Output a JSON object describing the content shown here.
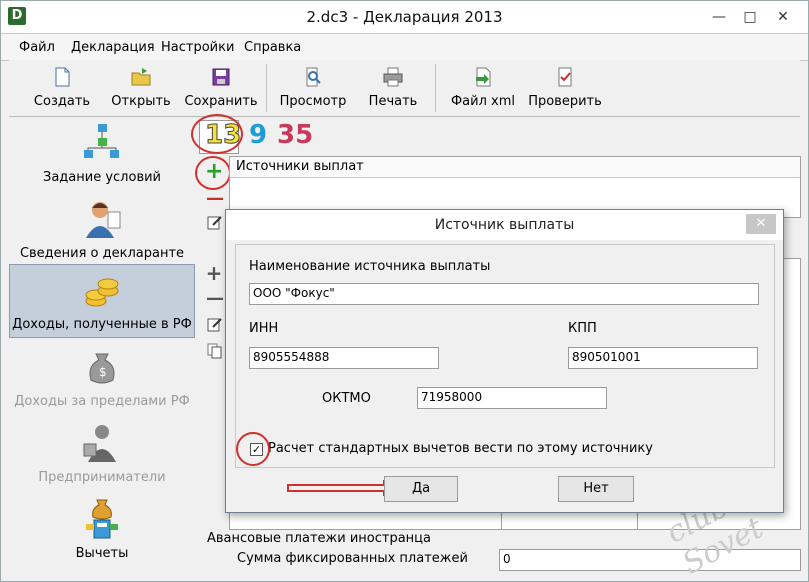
{
  "window": {
    "title": "2.dc3 - Декларация 2013",
    "app_icon": "D",
    "minimize": "—",
    "maximize": "□",
    "close": "✕"
  },
  "menu": [
    "Файл",
    "Декларация",
    "Настройки",
    "Справка"
  ],
  "toolbar": [
    {
      "label": "Создать",
      "icon": "new-document-icon"
    },
    {
      "label": "Открыть",
      "icon": "open-folder-icon"
    },
    {
      "label": "Сохранить",
      "icon": "save-disk-icon"
    },
    {
      "label": "Просмотр",
      "icon": "preview-icon"
    },
    {
      "label": "Печать",
      "icon": "printer-icon"
    },
    {
      "label": "Файл xml",
      "icon": "xml-file-icon"
    },
    {
      "label": "Проверить",
      "icon": "check-document-icon"
    }
  ],
  "sidebar": [
    {
      "label": "Задание условий",
      "icon": "conditions-tree-icon",
      "state": "normal"
    },
    {
      "label": "Сведения о декларанте",
      "icon": "person-icon",
      "state": "normal"
    },
    {
      "label": "Доходы, полученные в РФ",
      "icon": "coins-icon",
      "state": "active"
    },
    {
      "label": "Доходы за пределами РФ",
      "icon": "money-bag-icon",
      "state": "disabled"
    },
    {
      "label": "Предприниматели",
      "icon": "entrepreneur-icon",
      "state": "disabled"
    },
    {
      "label": "Вычеты",
      "icon": "deductions-icon",
      "state": "normal"
    }
  ],
  "rate_tabs": [
    {
      "label": "13",
      "color": "#f2e23a"
    },
    {
      "label": "9",
      "color": "#1f9bd6"
    },
    {
      "label": "35",
      "color": "#c8395a"
    }
  ],
  "income_sources": {
    "header": "Источники выплат"
  },
  "side_actions": {
    "add": "+",
    "remove": "—"
  },
  "dialog": {
    "title": "Источник выплаты",
    "close": "✕",
    "name_label": "Наименование источника выплаты",
    "name_value": "ООО \"Фокус\"",
    "inn_label": "ИНН",
    "inn_value": "8905554888",
    "kpp_label": "КПП",
    "kpp_value": "890501001",
    "oktmo_label": "ОКТМО",
    "oktmo_value": "71958000",
    "std_deductions_label": "Расчет стандартных вычетов вести по этому источнику",
    "std_deductions_checked": "✓",
    "yes_button": "Да",
    "no_button": "Нет"
  },
  "bottom": {
    "group_label": "Авансовые платежи иностранца",
    "fixed_payments_label": "Сумма фиксированных платежей",
    "fixed_payments_value": "0"
  },
  "watermark": "club Sovet",
  "colors": {
    "accent_red": "#d0312d",
    "active_sidebar": "#c5cfdb"
  }
}
